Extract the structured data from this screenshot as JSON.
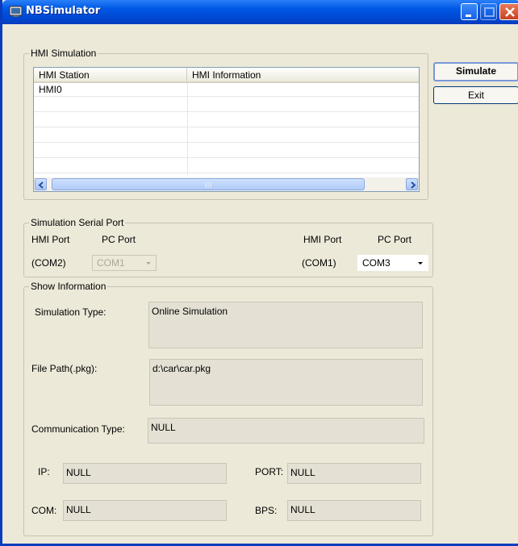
{
  "window": {
    "title": "NBSimulator"
  },
  "hmi_simulation": {
    "group_title": "HMI Simulation",
    "columns": [
      "HMI Station",
      "HMI Information"
    ],
    "rows": [
      [
        "HMI0",
        ""
      ]
    ]
  },
  "buttons": {
    "simulate": "Simulate",
    "exit": "Exit"
  },
  "serial_port": {
    "group_title": "Simulation Serial Port",
    "left": {
      "hmi_port_label": "HMI Port",
      "pc_port_label": "PC Port",
      "hmi_port_value": "(COM2)",
      "pc_port_selected": "COM1"
    },
    "right": {
      "hmi_port_label": "HMI Port",
      "pc_port_label": "PC Port",
      "hmi_port_value": "(COM1)",
      "pc_port_selected": "COM3"
    }
  },
  "show_information": {
    "group_title": "Show Information",
    "simulation_type_label": "Simulation Type:",
    "simulation_type_value": "Online Simulation",
    "file_path_label": "File Path(.pkg):",
    "file_path_value": "d:\\car\\car.pkg",
    "communication_type_label": "Communication Type:",
    "communication_type_value": "NULL",
    "ip_label": "IP:",
    "ip_value": "NULL",
    "port_label": "PORT:",
    "port_value": "NULL",
    "com_label": "COM:",
    "com_value": "NULL",
    "bps_label": "BPS:",
    "bps_value": "NULL"
  },
  "colors": {
    "titlebar": "#0058e6",
    "dialog_bg": "#ece9d8",
    "info_field_bg": "#e4e1d4"
  },
  "icons": [
    "app-icon",
    "minimize-icon",
    "maximize-icon",
    "close-icon",
    "scroll-left-icon",
    "scroll-right-icon",
    "dropdown-arrow-icon"
  ]
}
